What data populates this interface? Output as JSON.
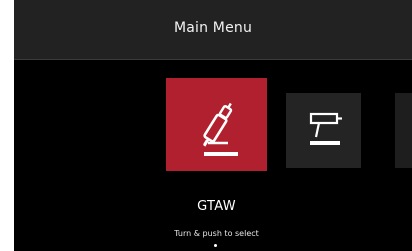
{
  "header": {
    "title": "Main Menu"
  },
  "menu": {
    "items": [
      {
        "label": "GTAW",
        "icon": "tig-torch-icon",
        "selected": true
      },
      {
        "label": "",
        "icon": "stick-electrode-holder-icon",
        "selected": false
      },
      {
        "label": "",
        "icon": "partial-menu-item",
        "selected": false
      }
    ],
    "selected_label": "GTAW"
  },
  "footer": {
    "hint": "Turn & push to select"
  },
  "colors": {
    "accent": "#b0202e",
    "background": "#000000",
    "header": "#222222",
    "tile": "#242424",
    "text": "#ffffff"
  }
}
